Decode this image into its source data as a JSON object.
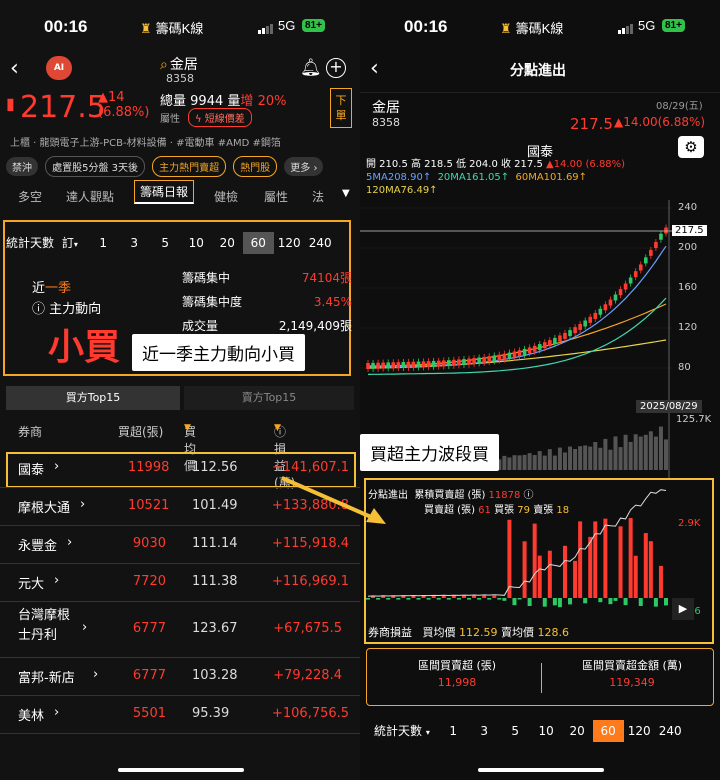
{
  "status": {
    "time": "00:16",
    "app": "籌碼K線",
    "net": "5G",
    "battery": "81+"
  },
  "left": {
    "stock_name": "金居",
    "stock_code": "8358",
    "price": "217.5",
    "change": "▲14",
    "change_pct": "(6.88%)",
    "vol_label": "總量",
    "vol": "9944",
    "vol2_label": "量",
    "vol2_dir": "增",
    "vol2_pct": "20%",
    "attr_label": "屬性",
    "attr_pill": "短線價差",
    "sell_btn": "下單",
    "tags": "上櫃 · 龍頭電子上游-PCB-材料設備 · #電動車 #AMD #鋼箔",
    "chips": [
      "禁沖",
      "處置股5分盤 3天後",
      "主力熱門賣超",
      "熱門股",
      "更多 ›"
    ],
    "tabs": [
      "多空",
      "達人觀點",
      "籌碼日報",
      "健檢",
      "屬性",
      "法"
    ],
    "days_label": "統計天數",
    "days_sub": "訂",
    "days": [
      "1",
      "3",
      "5",
      "10",
      "20",
      "60",
      "120",
      "240"
    ],
    "days_selected": "60",
    "force_line1a": "近",
    "force_line1b": "一季",
    "force_line2": "主力動向",
    "force_big": "小買",
    "metrics": [
      {
        "k": "籌碼集中",
        "v": "74104張",
        "c": "red"
      },
      {
        "k": "籌碼集中度",
        "v": "3.45%",
        "c": "red"
      },
      {
        "k": "成交量",
        "v": "2,149,409張",
        "c": "white"
      }
    ],
    "callout": "近一季主力動向小買",
    "top_tabs": [
      "買方Top15",
      "賣方Top15"
    ],
    "thead": [
      "券商",
      "買超(張)",
      "買均價",
      "ⓘ 損益(萬)"
    ],
    "rows": [
      {
        "name": "國泰",
        "buy": "11998",
        "avg": "112.56",
        "pl": "+141,607.1"
      },
      {
        "name": "摩根大通",
        "buy": "10521",
        "avg": "101.49",
        "pl": "+133,880.8"
      },
      {
        "name": "永豐金",
        "buy": "9030",
        "avg": "111.14",
        "pl": "+115,918.4"
      },
      {
        "name": "元大",
        "buy": "7720",
        "avg": "111.38",
        "pl": "+116,969.1"
      },
      {
        "name": "台灣摩根士丹利",
        "buy": "6777",
        "avg": "123.67",
        "pl": "+67,675.5"
      },
      {
        "name": "富邦-新店",
        "buy": "6777",
        "avg": "103.28",
        "pl": "+79,228.4"
      },
      {
        "name": "美林",
        "buy": "5501",
        "avg": "95.39",
        "pl": "+106,756.5"
      }
    ]
  },
  "right": {
    "title": "分點進出",
    "stock_name": "金居",
    "stock_code": "8358",
    "date": "08/29(五)",
    "price": "217.5",
    "change": "▲14.00(6.88%)",
    "broker": "國泰",
    "ohlc_open": "開 210.5",
    "ohlc_high": "高 218.5",
    "ohlc_low": "低 204.0",
    "ohlc_close": "收 217.5",
    "ohlc_chg": "▲14.00 (6.88%)",
    "ma5": "5MA208.90↑",
    "ma20": "20MA161.05↑",
    "ma60": "60MA101.69↑",
    "ma120": "120MA76.49↑",
    "y_ticks": [
      "240",
      "200",
      "160",
      "120",
      "80"
    ],
    "price_tag": "217.5",
    "date_tag": "2025/08/29",
    "vol_max": "125.7K",
    "callout": "買超主力波段買",
    "flow_title": "分點進出",
    "flow_cum_label": "累積買賣超 (張)",
    "flow_cum": "11878",
    "flow_net_label": "買賣超 (張)",
    "flow_net": "61",
    "flow_buy_label": "買張",
    "flow_buy": "79",
    "flow_sell_label": "賣張",
    "flow_sell": "18",
    "flow_max": "2.9K",
    "flow_min": "-576",
    "pl_label": "券商損益",
    "buy_avg_label": "買均價",
    "buy_avg": "112.59",
    "sell_avg_label": "賣均價",
    "sell_avg": "128.6",
    "sum1_label": "區間買賣超 (張)",
    "sum1_val": "11,998",
    "sum2_label": "區間買賣超金額 (萬)",
    "sum2_val": "119,349",
    "days_label": "統計天數",
    "days": [
      "1",
      "3",
      "5",
      "10",
      "20",
      "60",
      "120",
      "240"
    ],
    "days_selected": "60"
  }
}
